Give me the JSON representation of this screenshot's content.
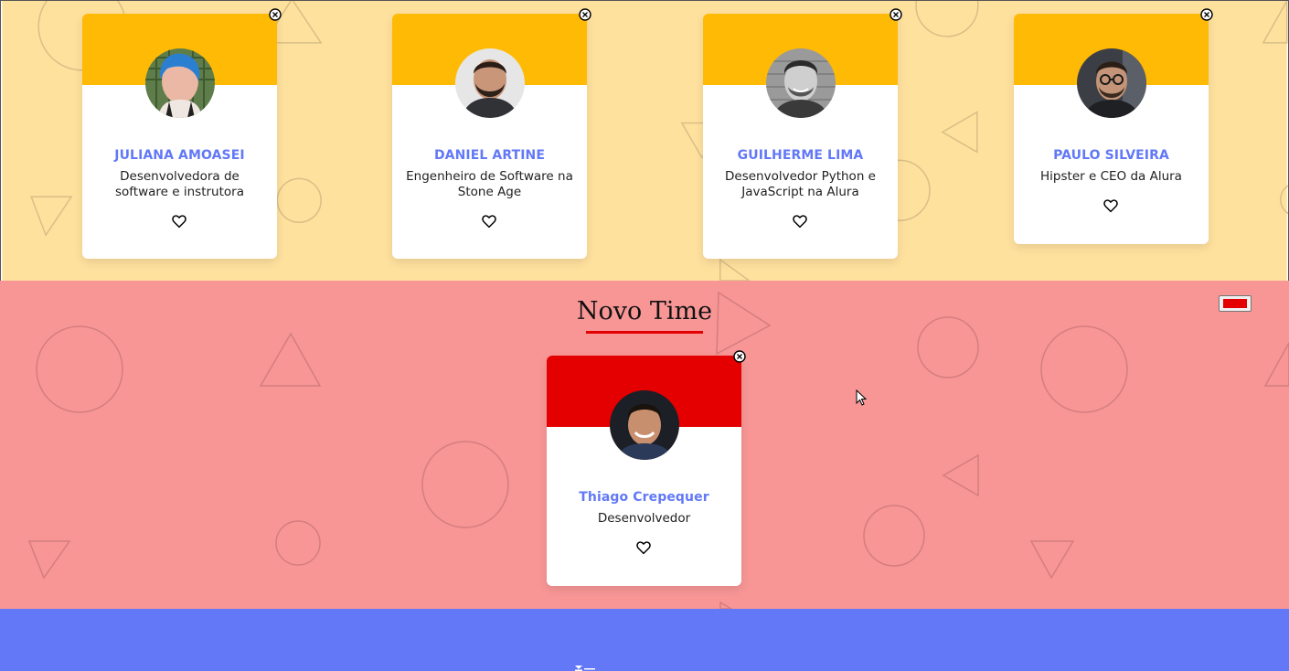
{
  "teams": [
    {
      "id": "team-top",
      "background_color": "#ffe19e",
      "header_color": "#ffba05",
      "title": "",
      "members": [
        {
          "name": "JULIANA AMOASEI",
          "role": "Desenvolvedora de software e instrutora",
          "avatar_icon": "person-photo-blue-hair",
          "favorite_icon": "heart-outline-icon",
          "close_icon": "close-circle-icon"
        },
        {
          "name": "DANIEL ARTINE",
          "role": "Engenheiro de Software na Stone Age",
          "avatar_icon": "person-photo-beard",
          "favorite_icon": "heart-outline-icon",
          "close_icon": "close-circle-icon"
        },
        {
          "name": "GUILHERME LIMA",
          "role": "Desenvolvedor Python e JavaScript na Alura",
          "avatar_icon": "person-photo-grayscale",
          "favorite_icon": "heart-outline-icon",
          "close_icon": "close-circle-icon"
        },
        {
          "name": "PAULO SILVEIRA",
          "role": "Hipster e CEO da Alura",
          "avatar_icon": "person-photo-glasses",
          "favorite_icon": "heart-outline-icon",
          "close_icon": "close-circle-icon"
        }
      ]
    },
    {
      "id": "team-novo-time",
      "background_color": "#f89696",
      "header_color": "#e40000",
      "title": "Novo Time",
      "color_input_value": "#e40000",
      "members": [
        {
          "name": "Thiago Crepequer",
          "role": "Desenvolvedor",
          "avatar_icon": "person-photo-smiling",
          "favorite_icon": "heart-outline-icon",
          "close_icon": "close-circle-icon"
        }
      ]
    }
  ],
  "footer": {
    "background_color": "#6278f7",
    "logo_icon": "logo-icon"
  },
  "colors": {
    "name_text": "#6278f7",
    "role_text": "#212121",
    "title_underline": "#e40000"
  }
}
